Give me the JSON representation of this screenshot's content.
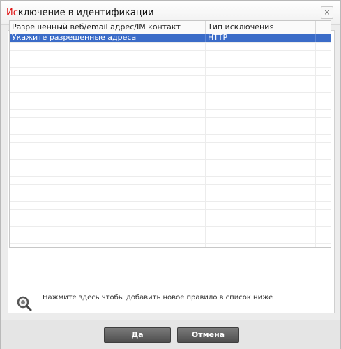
{
  "dialog": {
    "title_accent": "Ис",
    "title_rest": "ключение в идентификации",
    "close_symbol": "×"
  },
  "toolbar": {
    "add_symbol": "+",
    "remove_symbol": "−"
  },
  "table": {
    "columns": [
      "Разрешенный веб/email адрес/IM контакт",
      "Тип исключения",
      ""
    ],
    "rows": [
      {
        "address": "Укажите разрешенные адреса",
        "type": "HTTP",
        "selected": true
      }
    ]
  },
  "hint": {
    "text": "Нажмите здесь чтобы добавить новое правило в список ниже",
    "icon": "search-add-icon"
  },
  "buttons": {
    "ok": "Да",
    "cancel": "Отмена"
  },
  "colors": {
    "title_accent": "#e01010",
    "selection": "#3b6cc8",
    "button": "#5f5f5f"
  }
}
